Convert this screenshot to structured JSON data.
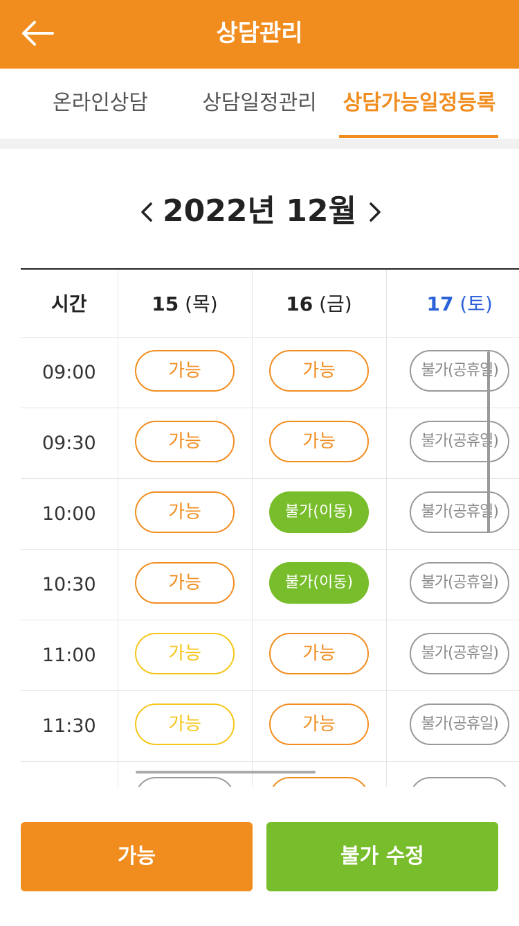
{
  "header": {
    "title": "상담관리",
    "back_icon": "arrow-left-icon"
  },
  "tabs": [
    {
      "label": "온라인상담",
      "active": false
    },
    {
      "label": "상담일정관리",
      "active": false
    },
    {
      "label": "상담가능일정등록",
      "active": true
    }
  ],
  "month_nav": {
    "title": "2022년 12월",
    "prev_icon": "chevron-left-icon",
    "next_icon": "chevron-right-icon"
  },
  "grid": {
    "time_header": "시간",
    "days": [
      {
        "num": "15",
        "weekday": "(목)",
        "saturday": false
      },
      {
        "num": "16",
        "weekday": "(금)",
        "saturday": false
      },
      {
        "num": "17",
        "weekday": "(토)",
        "saturday": true
      }
    ],
    "rows": [
      {
        "time": "09:00",
        "slots": [
          {
            "label": "가능",
            "style": "ok"
          },
          {
            "label": "가능",
            "style": "ok"
          },
          {
            "label": "불가(공휴일)",
            "style": "holiday"
          }
        ]
      },
      {
        "time": "09:30",
        "slots": [
          {
            "label": "가능",
            "style": "ok"
          },
          {
            "label": "가능",
            "style": "ok"
          },
          {
            "label": "불가(공휴일)",
            "style": "holiday"
          }
        ]
      },
      {
        "time": "10:00",
        "slots": [
          {
            "label": "가능",
            "style": "ok"
          },
          {
            "label": "불가(이동)",
            "style": "move"
          },
          {
            "label": "불가(공휴일)",
            "style": "holiday"
          }
        ]
      },
      {
        "time": "10:30",
        "slots": [
          {
            "label": "가능",
            "style": "ok"
          },
          {
            "label": "불가(이동)",
            "style": "move"
          },
          {
            "label": "불가(공휴일)",
            "style": "holiday"
          }
        ]
      },
      {
        "time": "11:00",
        "slots": [
          {
            "label": "가능",
            "style": "ok-yellow"
          },
          {
            "label": "가능",
            "style": "ok"
          },
          {
            "label": "불가(공휴일)",
            "style": "holiday"
          }
        ]
      },
      {
        "time": "11:30",
        "slots": [
          {
            "label": "가능",
            "style": "ok-yellow"
          },
          {
            "label": "가능",
            "style": "ok"
          },
          {
            "label": "불가(공휴일)",
            "style": "holiday"
          }
        ]
      }
    ]
  },
  "colors": {
    "brand_orange": "#f18d1f",
    "green": "#78bd2b",
    "yellow": "#f5c61a",
    "saturday_blue": "#2b62d9"
  },
  "buttons": {
    "available": "가능",
    "edit_unavailable": "불가 수정"
  }
}
